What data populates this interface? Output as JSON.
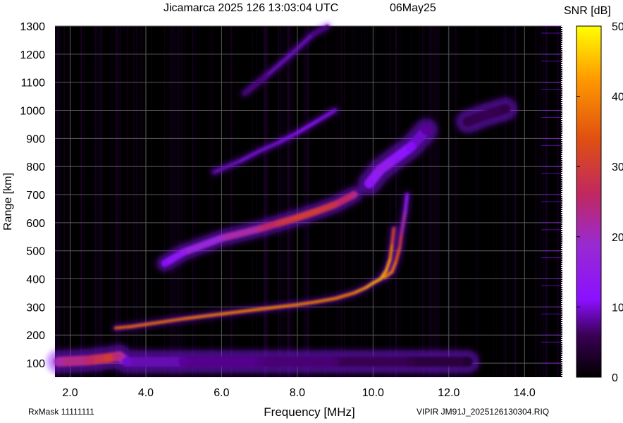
{
  "header": {
    "title": "Jicamarca 2025 126 13:03:04 UTC",
    "date": "06May25"
  },
  "footer": {
    "rxmask": "RxMask 11111111",
    "file": "VIPIR  JM91J_2025126130304.RIQ"
  },
  "colors": {
    "background": "#000000",
    "grid": "#5a5a5a",
    "colormap": [
      "#000000",
      "#3a0055",
      "#8a10ff",
      "#9a2ad0",
      "#c02860",
      "#e05010",
      "#ff9a00",
      "#ffff00"
    ]
  },
  "chart_data": {
    "type": "heatmap",
    "title": "Jicamarca 2025 126 13:03:04 UTC",
    "xlabel": "Frequency [MHz]",
    "ylabel": "Range [km]",
    "xlim": [
      1.6,
      15.0
    ],
    "ylim": [
      50,
      1300
    ],
    "x_ticks": [
      "2.0",
      "4.0",
      "6.0",
      "8.0",
      "10.0",
      "12.0",
      "14.0"
    ],
    "y_ticks": [
      "100",
      "200",
      "300",
      "400",
      "500",
      "600",
      "700",
      "800",
      "900",
      "1000",
      "1100",
      "1200",
      "1300"
    ],
    "colorbar": {
      "label": "SNR [dB]",
      "range": [
        0,
        50
      ],
      "ticks": [
        "0",
        "10",
        "20",
        "30",
        "40",
        "50"
      ]
    },
    "traces": [
      {
        "kind": "E-region echo",
        "points": [
          [
            1.7,
            105,
            24
          ],
          [
            2.5,
            110,
            28
          ],
          [
            3.0,
            118,
            32
          ],
          [
            3.3,
            125,
            26
          ],
          [
            3.5,
            105,
            12
          ],
          [
            5.0,
            105,
            10
          ],
          [
            7.0,
            105,
            9
          ],
          [
            9.0,
            105,
            8
          ],
          [
            11.0,
            105,
            6
          ],
          [
            12.5,
            105,
            4
          ]
        ]
      },
      {
        "kind": "F-region O-mode",
        "points": [
          [
            3.2,
            225,
            36
          ],
          [
            3.6,
            230,
            38
          ],
          [
            4.0,
            238,
            38
          ],
          [
            5.0,
            258,
            38
          ],
          [
            6.0,
            275,
            40
          ],
          [
            7.0,
            292,
            40
          ],
          [
            8.0,
            308,
            40
          ],
          [
            8.5,
            318,
            40
          ],
          [
            9.0,
            330,
            40
          ],
          [
            9.5,
            350,
            40
          ],
          [
            9.8,
            368,
            42
          ],
          [
            10.0,
            385,
            44
          ],
          [
            10.2,
            400,
            44
          ],
          [
            10.35,
            430,
            44
          ],
          [
            10.45,
            470,
            42
          ],
          [
            10.5,
            520,
            38
          ],
          [
            10.55,
            580,
            30
          ]
        ]
      },
      {
        "kind": "F-region X-mode",
        "points": [
          [
            10.3,
            405,
            40
          ],
          [
            10.5,
            425,
            40
          ],
          [
            10.6,
            460,
            38
          ],
          [
            10.7,
            510,
            34
          ],
          [
            10.75,
            560,
            28
          ],
          [
            10.85,
            640,
            20
          ],
          [
            10.9,
            700,
            14
          ]
        ]
      },
      {
        "kind": "Second-hop echo",
        "points": [
          [
            4.5,
            455,
            14
          ],
          [
            5.0,
            495,
            18
          ],
          [
            6.0,
            545,
            22
          ],
          [
            7.0,
            578,
            26
          ],
          [
            7.5,
            598,
            30
          ],
          [
            8.0,
            618,
            32
          ],
          [
            8.5,
            640,
            32
          ],
          [
            9.0,
            665,
            30
          ],
          [
            9.5,
            700,
            26
          ]
        ]
      },
      {
        "kind": "Spread echo",
        "points": [
          [
            9.9,
            740,
            16
          ],
          [
            10.2,
            790,
            18
          ],
          [
            10.6,
            830,
            16
          ],
          [
            11.0,
            870,
            14
          ],
          [
            11.4,
            930,
            10
          ]
        ]
      },
      {
        "kind": "Third-hop echo",
        "points": [
          [
            5.8,
            780,
            10
          ],
          [
            6.5,
            820,
            12
          ],
          [
            7.0,
            855,
            12
          ],
          [
            7.5,
            885,
            12
          ],
          [
            8.0,
            920,
            14
          ],
          [
            8.5,
            960,
            14
          ],
          [
            9.0,
            1000,
            12
          ]
        ]
      },
      {
        "kind": "Fourth-hop echo",
        "points": [
          [
            6.6,
            1060,
            8
          ],
          [
            7.2,
            1125,
            10
          ],
          [
            7.8,
            1195,
            12
          ],
          [
            8.4,
            1270,
            10
          ],
          [
            8.8,
            1300,
            8
          ]
        ]
      },
      {
        "kind": "Diffuse echo",
        "points": [
          [
            12.5,
            960,
            6
          ],
          [
            13.0,
            985,
            7
          ],
          [
            13.5,
            1005,
            6
          ]
        ]
      }
    ]
  }
}
